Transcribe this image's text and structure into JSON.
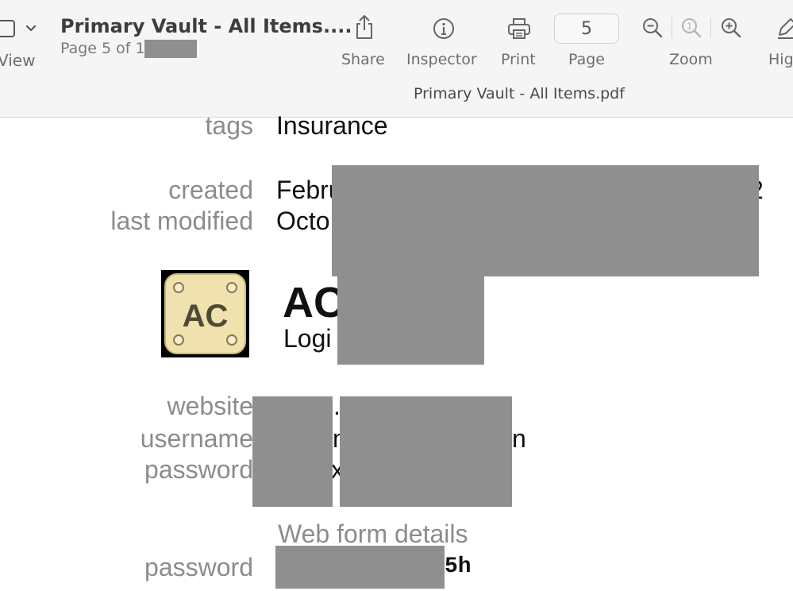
{
  "toolbar": {
    "view_label": "View",
    "title": "Primary Vault - All Items....",
    "subtitle": "Page 5 of 1",
    "share_label": "Share",
    "inspector_label": "Inspector",
    "print_label": "Print",
    "page_label": "Page",
    "page_value": "5",
    "zoom_label": "Zoom",
    "highlight_label": "Hig",
    "filename": "Primary Vault - All Items.pdf"
  },
  "document": {
    "tags_label": "tags",
    "tags_value": "Insurance",
    "created_label": "created",
    "created_value": "Febru",
    "created_tail": "2",
    "modified_label": "last modified",
    "modified_value": "Octo",
    "item_icon_text": "AC",
    "item_title": "AC",
    "item_type": "Logi",
    "website_label": "website",
    "website_value": ".",
    "username_label": "username",
    "username_value_a": "m",
    "username_value_b": "n",
    "password_label": "password",
    "password_value": "x",
    "section_title": "Web form details",
    "webform_password_label": "password",
    "webform_password_value": "5h"
  },
  "colors": {
    "toolbar_bg": "#f5f5f5",
    "label_gray": "#8c8c8c",
    "redaction": "#8f8f8f",
    "icon_bg": "#efe2ae"
  },
  "icons": [
    "sidebar-icon",
    "chevron-down-icon",
    "share-icon",
    "info-icon",
    "printer-icon",
    "zoom-out-icon",
    "zoom-actual-icon",
    "zoom-in-icon",
    "highlight-pen-icon"
  ]
}
